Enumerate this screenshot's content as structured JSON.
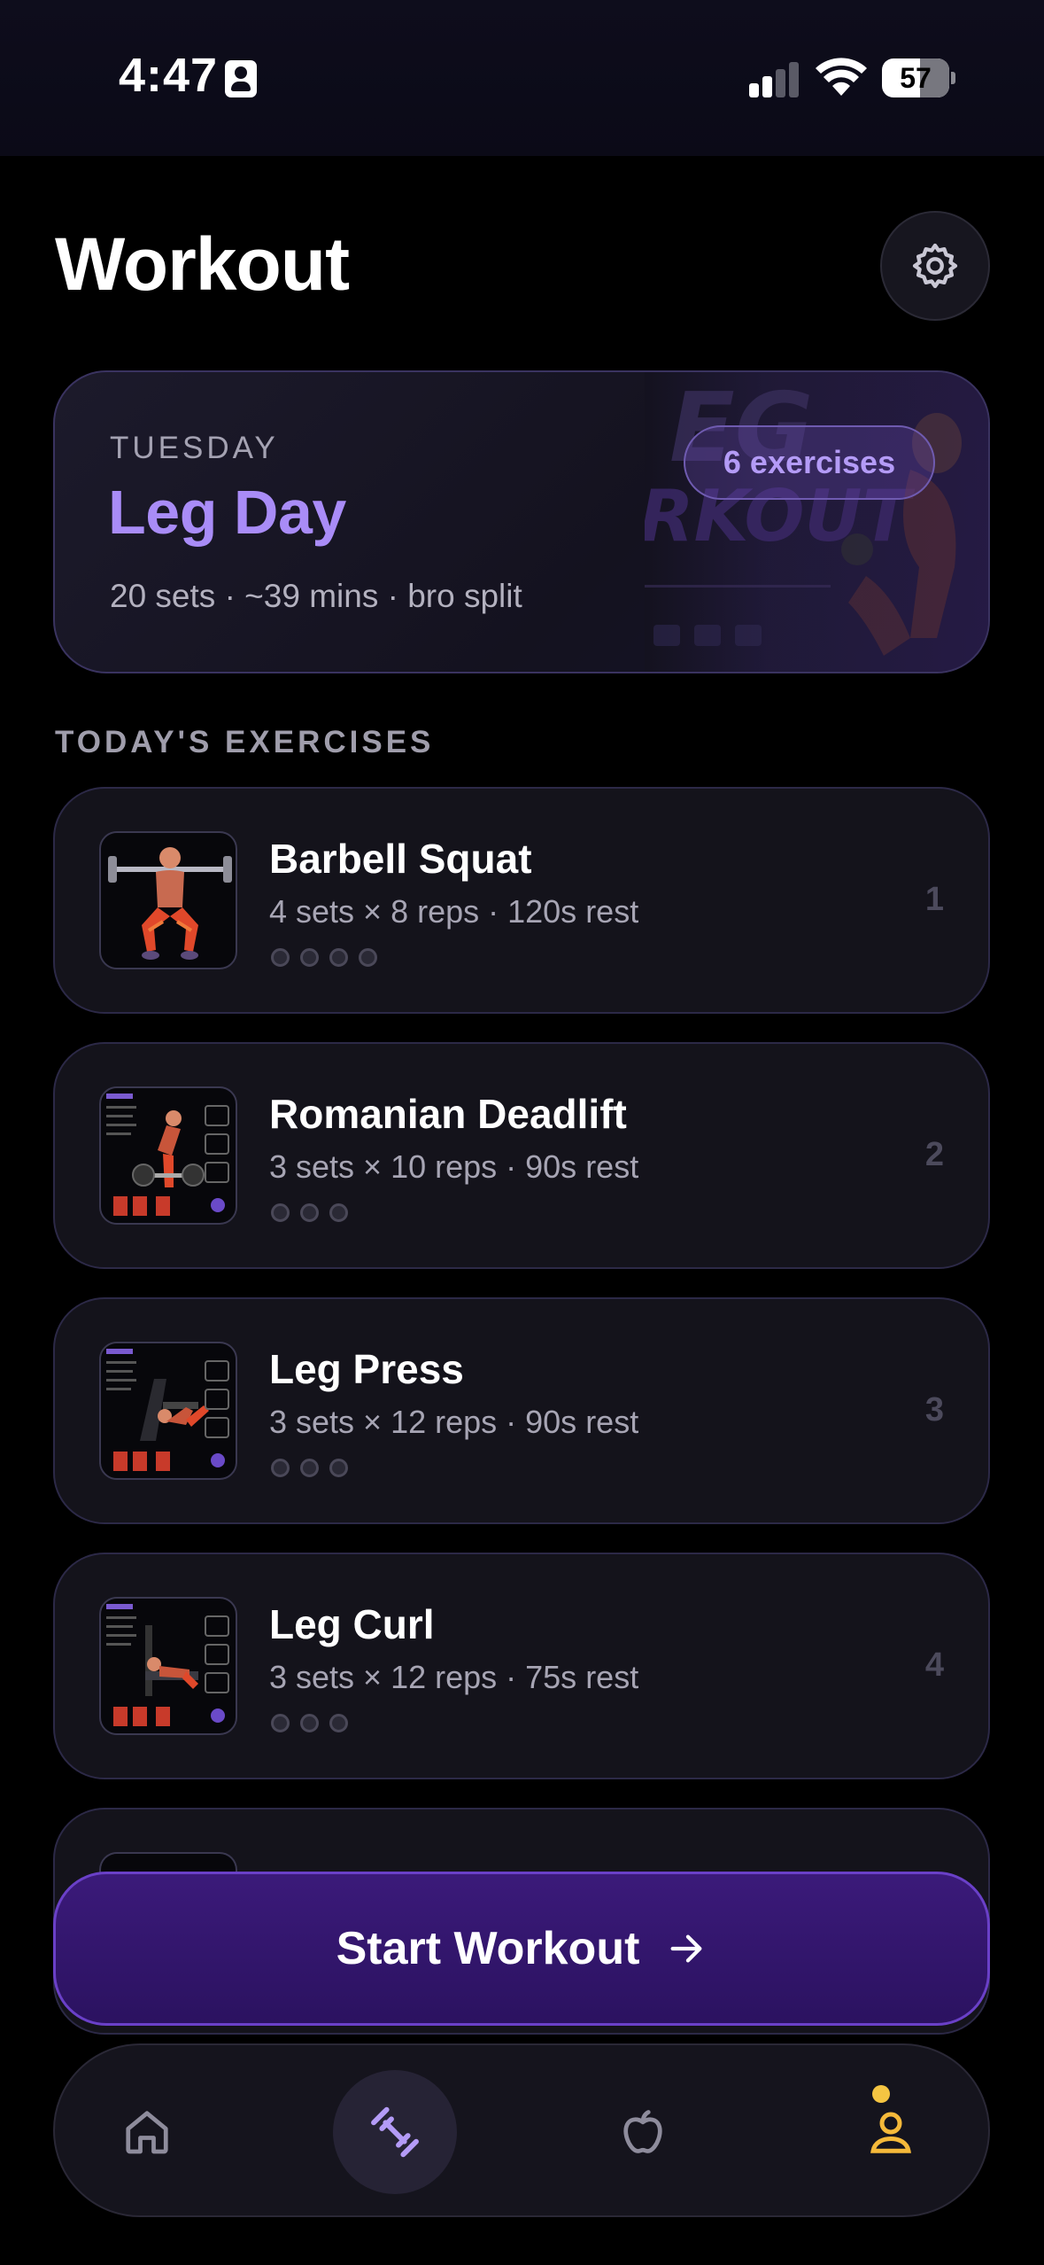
{
  "status_bar": {
    "time": "4:47",
    "battery_level": "57",
    "battery_fraction": 0.57,
    "icons": [
      "contact-card-icon",
      "cellular-signal-icon",
      "wifi-icon",
      "battery-icon"
    ]
  },
  "header": {
    "title": "Workout",
    "settings_icon": "gear-icon"
  },
  "hero": {
    "day": "TUESDAY",
    "name": "Leg Day",
    "meta": "20 sets · ~39 mins · bro split",
    "badge": "6 exercises"
  },
  "section": {
    "label": "TODAY'S EXERCISES"
  },
  "exercises": [
    {
      "name": "Barbell Squat",
      "detail": "4 sets × 8 reps · 120s rest",
      "index": "1",
      "sets": 4
    },
    {
      "name": "Romanian Deadlift",
      "detail": "3 sets × 10 reps · 90s rest",
      "index": "2",
      "sets": 3
    },
    {
      "name": "Leg Press",
      "detail": "3 sets × 12 reps · 90s rest",
      "index": "3",
      "sets": 3
    },
    {
      "name": "Leg Curl",
      "detail": "3 sets × 12 reps · 75s rest",
      "index": "4",
      "sets": 3
    }
  ],
  "cta": {
    "label": "Start Workout",
    "icon": "arrow-right-icon"
  },
  "tab_bar": {
    "items": [
      {
        "icon": "home-icon",
        "active": false
      },
      {
        "icon": "dumbbell-icon",
        "active": true
      },
      {
        "icon": "apple-icon",
        "active": false
      },
      {
        "icon": "profile-icon",
        "active": false,
        "badge": true
      }
    ]
  },
  "colors": {
    "accent": "#a98cf7",
    "cta": "#2b1260",
    "notify": "#f5c542",
    "profile": "#f5b93a"
  }
}
